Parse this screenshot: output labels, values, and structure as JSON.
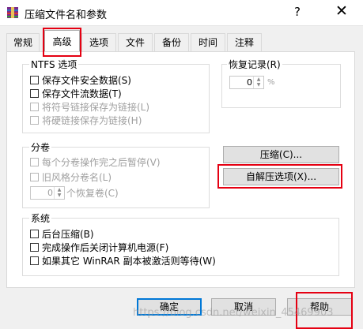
{
  "window": {
    "title": "压缩文件名和参数",
    "help_glyph": "?",
    "close_glyph": "✕"
  },
  "tabs": [
    {
      "label": "常规"
    },
    {
      "label": "高级",
      "active": true
    },
    {
      "label": "选项"
    },
    {
      "label": "文件"
    },
    {
      "label": "备份"
    },
    {
      "label": "时间"
    },
    {
      "label": "注释"
    }
  ],
  "ntfs": {
    "title": "NTFS 选项",
    "items": [
      {
        "label": "保存文件安全数据(S)",
        "checked": false,
        "enabled": true
      },
      {
        "label": "保存文件流数据(T)",
        "checked": false,
        "enabled": true
      },
      {
        "label": "将符号链接保存为链接(L)",
        "checked": false,
        "enabled": false
      },
      {
        "label": "将硬链接保存为链接(H)",
        "checked": false,
        "enabled": false
      }
    ]
  },
  "recovery": {
    "title": "恢复记录(R)",
    "value": "0",
    "unit": "%"
  },
  "volumes": {
    "title": "分卷",
    "items": [
      {
        "label": "每个分卷操作完之后暂停(V)",
        "checked": false,
        "enabled": false
      },
      {
        "label": "旧风格分卷名(L)",
        "checked": false,
        "enabled": false
      }
    ],
    "recovery_volumes": {
      "value": "0",
      "label": "个恢复卷(C)"
    }
  },
  "buttons": {
    "compress": "压缩(C)...",
    "sfx_options": "自解压选项(X)...",
    "ok": "确定",
    "cancel": "取消",
    "help": "帮助"
  },
  "system": {
    "title": "系统",
    "items": [
      {
        "label": "后台压缩(B)",
        "checked": false
      },
      {
        "label": "完成操作后关闭计算机电源(F)",
        "checked": false
      },
      {
        "label": "如果其它 WinRAR 副本被激活则等待(W)",
        "checked": false
      }
    ]
  },
  "watermark": "https://blog.csdn.net/weixin_45469903",
  "colors": {
    "highlight": "#e50012",
    "default_button_border": "#0078d7"
  }
}
